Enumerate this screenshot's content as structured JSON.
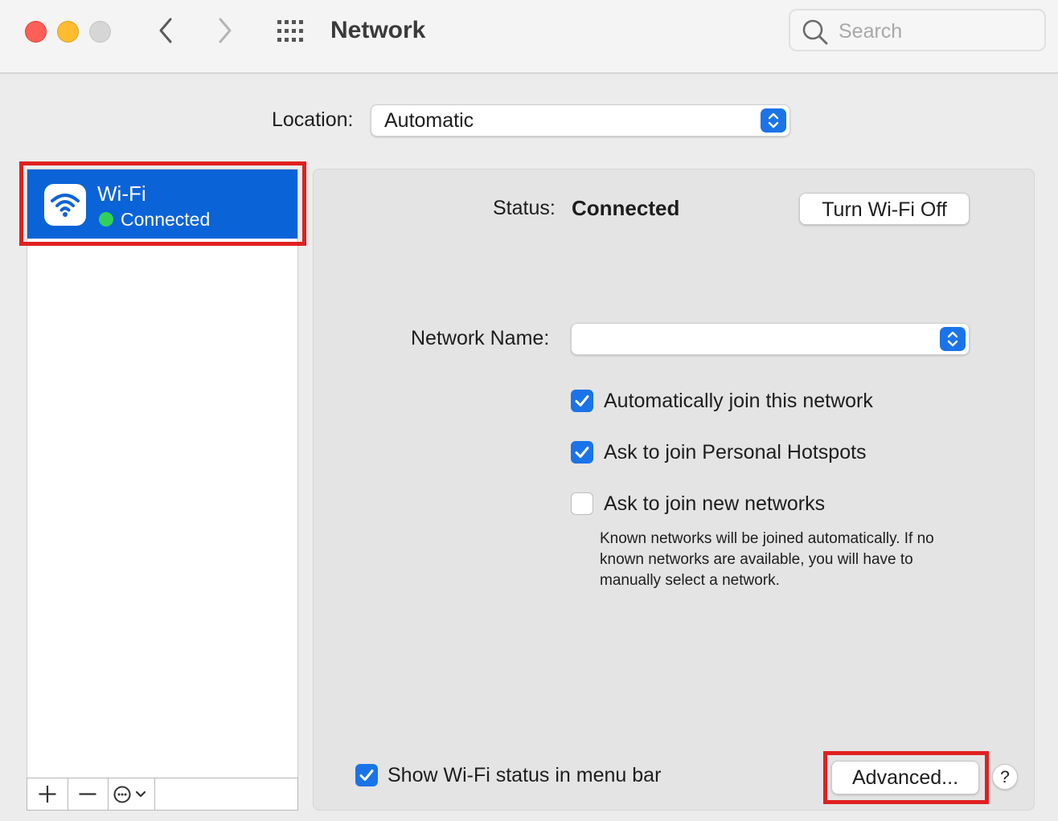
{
  "window": {
    "title": "Network",
    "search_placeholder": "Search"
  },
  "location": {
    "label": "Location:",
    "value": "Automatic"
  },
  "sidebar": {
    "items": [
      {
        "name": "Wi-Fi",
        "status": "Connected",
        "status_color": "#30d158",
        "icon": "wifi-icon"
      }
    ],
    "toolbar": {
      "add": "+",
      "remove": "–",
      "more": "ellipsis-circle-icon"
    }
  },
  "detail": {
    "status_label": "Status:",
    "status_value": "Connected",
    "turn_off_label": "Turn Wi-Fi Off",
    "network_name_label": "Network Name:",
    "network_name_value": "",
    "options": [
      {
        "label": "Automatically join this network",
        "checked": true
      },
      {
        "label": "Ask to join Personal Hotspots",
        "checked": true
      },
      {
        "label": "Ask to join new networks",
        "checked": false
      }
    ],
    "help_text": "Known networks will be joined automatically. If no known networks are available, you will have to manually select a network.",
    "show_status_label": "Show Wi-Fi status in menu bar",
    "show_status_checked": true,
    "advanced_label": "Advanced...",
    "help_button": "?"
  },
  "colors": {
    "accent": "#1a74e8",
    "selection": "#0b63d8",
    "highlight_box": "#e02020"
  }
}
